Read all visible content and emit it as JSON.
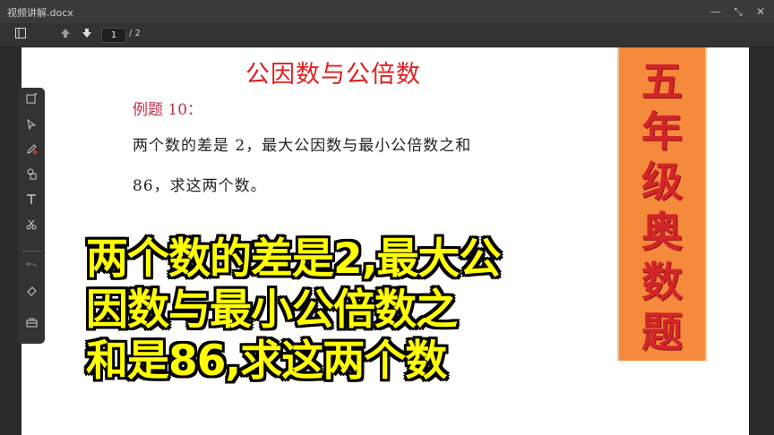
{
  "window": {
    "title": "视频讲解.docx",
    "controls": {
      "minimize": "—",
      "restore": "⤡",
      "close": "✕"
    }
  },
  "toolbar": {
    "sidebar_icon": "sidebar-toggle-icon",
    "page_current": "1",
    "page_total": "/ 2"
  },
  "document": {
    "title": "公因数与公倍数",
    "example_label": "例题 10：",
    "problem_line1": "两个数的差是 2，最大公因数与最小公倍数之和",
    "problem_line2": "86，求这两个数。"
  },
  "banner": {
    "chars": [
      "五",
      "年",
      "级",
      "奥",
      "数",
      "题"
    ]
  },
  "caption": {
    "line1": "两个数的差是2,最大公",
    "line2": "因数与最小公倍数之",
    "line3": "和是86,求这两个数"
  },
  "colors": {
    "caption_fill": "#ffff00",
    "banner_bg": "#f58a3c",
    "banner_text": "#d3242a",
    "doc_title": "#e02020"
  }
}
